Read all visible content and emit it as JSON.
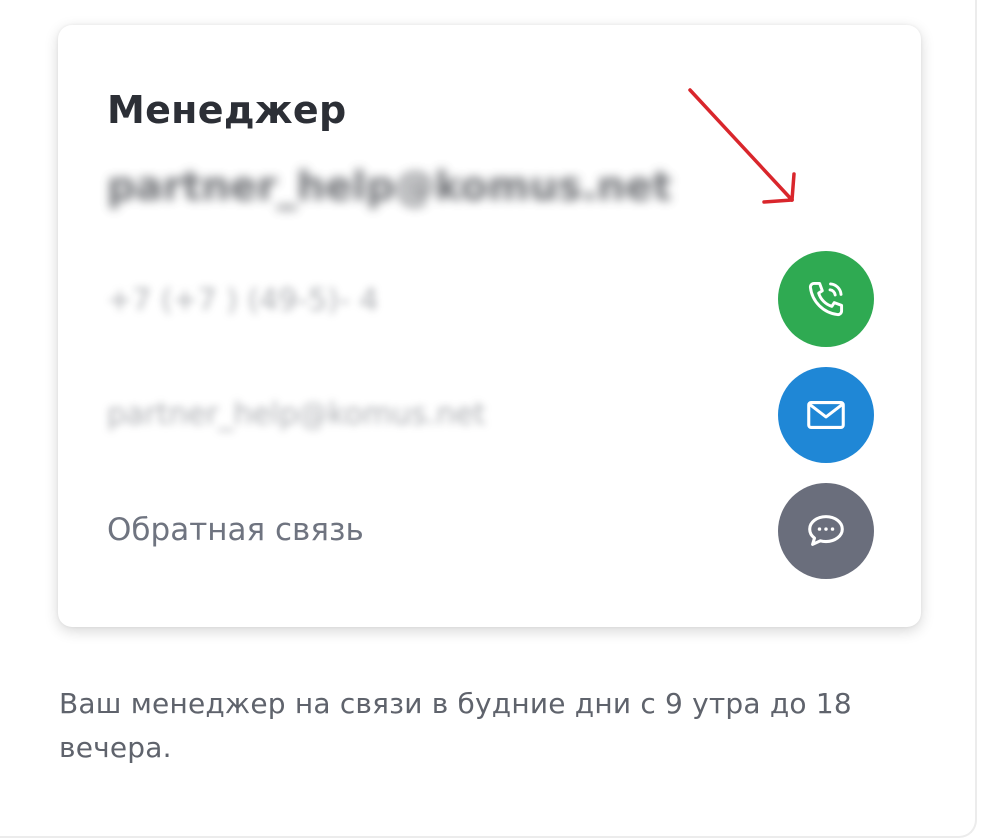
{
  "contact_card": {
    "title": "Менеджер",
    "email_heading": "partner_help@komus.net",
    "phone_value": "+7 (+7 ) (49-5)- 4",
    "email_value": "partner_help@komus.net",
    "feedback_label": "Обратная связь"
  },
  "actions": {
    "phone_icon": "phone-icon",
    "mail_icon": "envelope-icon",
    "chat_icon": "chat-bubble-icon"
  },
  "colors": {
    "phone_button": "#2faa52",
    "mail_button": "#1f87d6",
    "chat_button": "#6a6e7c",
    "annotation_arrow": "#d9262c"
  },
  "footnote": "Ваш менеджер на связи в будние дни с 9 утра до 18 вечера."
}
